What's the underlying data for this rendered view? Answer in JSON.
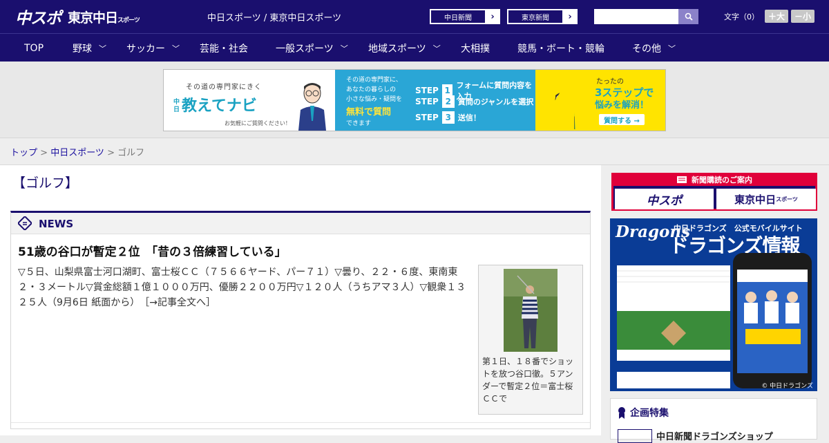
{
  "header": {
    "logo_chuspo": "中スポ",
    "logo_tokyo": "東京中日",
    "logo_tokyo_small": "スポーツ",
    "site_names": "中日スポーツ / 東京中日スポーツ",
    "paper_links": [
      {
        "label": "中日新聞"
      },
      {
        "label": "東京新聞"
      }
    ],
    "font_size_label": "文字（0）",
    "font_larger": "＋大",
    "font_smaller": "－小"
  },
  "nav": {
    "items": [
      {
        "label": "TOP",
        "has_menu": false
      },
      {
        "label": "野球",
        "has_menu": true
      },
      {
        "label": "サッカー",
        "has_menu": true
      },
      {
        "label": "芸能・社会",
        "has_menu": false
      },
      {
        "label": "一般スポーツ",
        "has_menu": true
      },
      {
        "label": "地域スポーツ",
        "has_menu": true
      },
      {
        "label": "大相撲",
        "has_menu": false
      },
      {
        "label": "競馬・ボート・競輪",
        "has_menu": false
      },
      {
        "label": "その他",
        "has_menu": true
      }
    ]
  },
  "ad_banner": {
    "tagline": "その道の専門家にきく",
    "brand_prefix": "中日",
    "brand": "教えてナビ",
    "sub": "お気軽にご質問ください！",
    "question_lines": [
      "その道の専門家に、",
      "あなたの暮らしの",
      "小さな悩み・疑問を"
    ],
    "free": "無料で質問",
    "dekimasu": "できます",
    "steps": [
      {
        "label": "STEP",
        "num": "1",
        "text": "フォームに質問内容を入力"
      },
      {
        "label": "STEP",
        "num": "2",
        "text": "質問のジャンルを選択"
      },
      {
        "label": "STEP",
        "num": "3",
        "text": "送信！"
      }
    ],
    "right_small": "たったの",
    "right_big": "3ステップで",
    "right_big2": "悩みを解消！",
    "ask_button": "質問する →"
  },
  "breadcrumb": {
    "home": "トップ",
    "sep1": " > ",
    "section": "中日スポーツ",
    "sep2": " > ",
    "current": "ゴルフ"
  },
  "page": {
    "title": "【ゴルフ】"
  },
  "news": {
    "heading": "NEWS",
    "article": {
      "title": "51歳の谷口が暫定２位　「昔の３倍練習している」",
      "body": "▽５日、山梨県富士河口湖町、富士桜ＣＣ（７５６６ヤード、パー７１）▽曇り、２２・６度、東南東２・３メートル▽賞金総額１億１０００万円、優勝２２００万円▽１２０人（うちアマ３人）▽観衆１３２５人（9月6日 紙面から）",
      "more_link": "［→記事全文へ］",
      "caption": "第１日、１８番でショットを放つ谷口徹。５アンダーで暫定２位＝富士桜ＣＣで"
    }
  },
  "sidebar": {
    "subscribe_label": "新聞購読のご案内",
    "subscribe_logo1": "中スポ",
    "subscribe_logo2": "東京中日",
    "subscribe_logo2_small": "スポーツ",
    "dragons_brand": "Dragons",
    "dragons_sub": "中日ドラゴンズ　公式モバイルサイト",
    "dragons_title": "ドラゴンズ情報",
    "dragons_copyright": "© 中日ドラゴンズ",
    "feature_heading": "企画特集",
    "feature_item": "中日新聞ドラゴンズショップ"
  },
  "colors": {
    "brand_navy": "#1a0f6e",
    "accent_red": "#e0003a",
    "link_blue": "#1a0f9e",
    "ad_blue": "#2aa6d6",
    "ad_yellow": "#ffe400",
    "dragons_blue": "#0a3c96"
  }
}
